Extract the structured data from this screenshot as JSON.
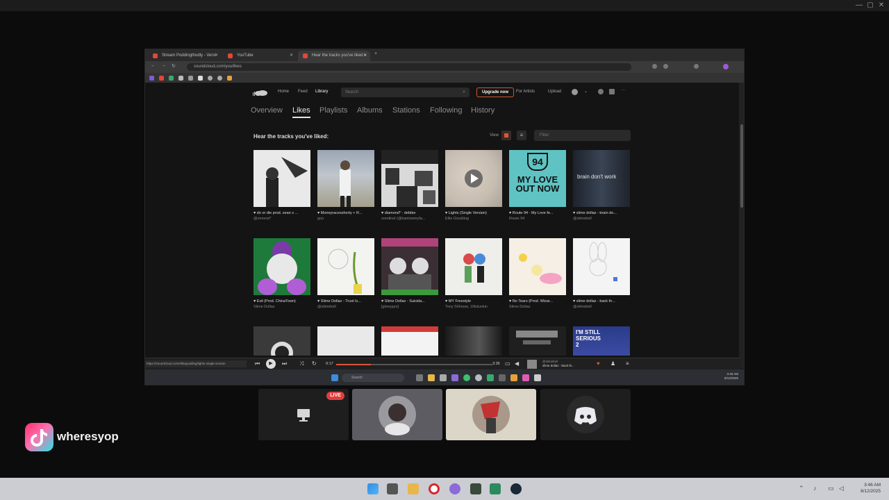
{
  "window": {
    "min_label": "—",
    "max_label": "▢",
    "close_label": "✕"
  },
  "browser": {
    "tabs": [
      {
        "label": "Stream Poddingthodly - Versi",
        "close": "✕"
      },
      {
        "label": "YouTube",
        "close": "✕"
      },
      {
        "label": "Hear the tracks you've liked o",
        "close": "✕"
      }
    ],
    "new_tab": "+",
    "url": "soundcloud.com/you/likes",
    "nav": {
      "back": "←",
      "forward": "→",
      "reload": "↻"
    }
  },
  "soundcloud": {
    "nav": [
      "Home",
      "Feed",
      "Library"
    ],
    "search_placeholder": "Search",
    "upgrade": "Upgrade now",
    "for_artists": "For Artists",
    "upload": "Upload",
    "more": "···",
    "subnav": [
      "Overview",
      "Likes",
      "Playlists",
      "Albums",
      "Stations",
      "Following",
      "History"
    ],
    "likes_heading": "Hear the tracks you've liked:",
    "view_label": "View",
    "filter_placeholder": "Filter",
    "tracks_row1": [
      {
        "title": "♥ do or die prod. zean x ...",
        "artist": "@xmonst*"
      },
      {
        "title": "♥ Moneyracesshorty + R...",
        "artist": "goo"
      },
      {
        "title": "♥ diamond* - debbie",
        "artist": "sondinol (@kantowmyfa..."
      },
      {
        "title": "♥ Lights (Single Version)",
        "artist": "Ellie Goulding"
      },
      {
        "title": "♥ Route 94 - My Love fe...",
        "artist": "Route 94"
      },
      {
        "title": "♥ slime dollaz - brain do...",
        "artist": "@slimebxll"
      }
    ],
    "tracks_row2": [
      {
        "title": "♥ Evil (Prod. ChinaTown)",
        "artist": "Slime Dollaz"
      },
      {
        "title": "♥ Slime Dollaz - Trust Is...",
        "artist": "@slimebxll"
      },
      {
        "title": "♥ Slime Dollaz - Suicida...",
        "artist": "[gloeypyo]"
      },
      {
        "title": "♥ MY Freestyle",
        "artist": "Tony Shhnow, 10kdunkin"
      },
      {
        "title": "♥ No Tears (Prod. Wizar...",
        "artist": "Slime Dollaz"
      },
      {
        "title": "♥ slime dollaz - back th...",
        "artist": "@slimebxll"
      }
    ],
    "art_text": {
      "route94_top": "94",
      "route94_line1": "MY LOVE",
      "route94_line2": "OUT NOW",
      "brain_text": "brain don't work",
      "im_still": "I'M STILL SERIOUS 2"
    },
    "player": {
      "status_url": "https://soundcloud.com/elliegoulding/lights-single-version",
      "elapsed": "0:17",
      "duration": "3:36",
      "progress_fraction": 0.22,
      "track_user": "@slimebxll",
      "track_title": "slime dollaz - back th..."
    }
  },
  "inner_taskbar": {
    "search": "Search",
    "time": "3:46 AM",
    "date": "8/12/2025"
  },
  "call": {
    "live_badge": "LIVE"
  },
  "overlay": {
    "tiktok_name": "wheresyop"
  },
  "taskbar": {
    "time": "3:46 AM",
    "date": "8/12/2025"
  },
  "colors": {
    "accent": "#d9583b",
    "live": "#e23e3e",
    "discord": "#5865f2"
  }
}
